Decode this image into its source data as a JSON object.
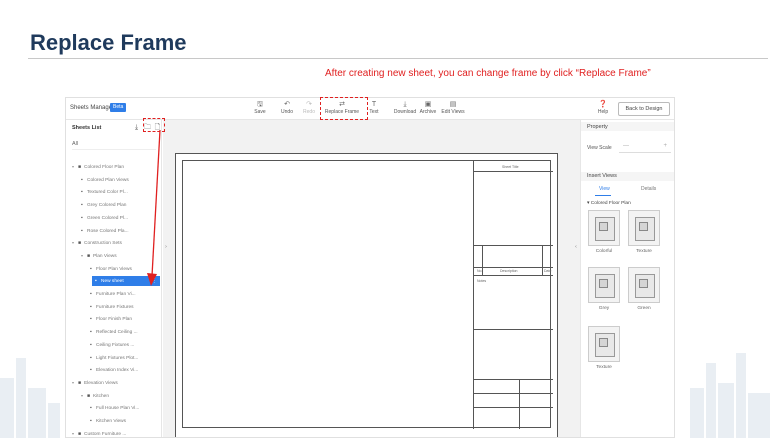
{
  "slide": {
    "title": "Replace Frame",
    "caption": "After creating new sheet, you can change frame by click “Replace Frame”"
  },
  "app": {
    "title": "Sheets Manager",
    "badge": "Beta",
    "toolbar": [
      {
        "label": "Save",
        "icon": "save-icon",
        "disabled": false
      },
      {
        "label": "Undo",
        "icon": "undo-icon",
        "disabled": false
      },
      {
        "label": "Redo",
        "icon": "redo-icon",
        "disabled": true
      },
      {
        "label": "Replace Frame",
        "icon": "replace-frame-icon",
        "disabled": false
      },
      {
        "label": "Text",
        "icon": "text-icon",
        "disabled": false
      },
      {
        "label": "Download",
        "icon": "download-icon",
        "disabled": false
      },
      {
        "label": "Archive",
        "icon": "archive-icon",
        "disabled": false
      },
      {
        "label": "Edit Views",
        "icon": "edit-views-icon",
        "disabled": false
      }
    ],
    "help_label": "Help",
    "back_button": "Back to Design"
  },
  "sidebar": {
    "title": "Sheets List",
    "search_value": "All",
    "tree": [
      {
        "label": "Colored Floor Plan",
        "level": 0,
        "type": "folder",
        "expanded": true
      },
      {
        "label": "Colored Plan Views",
        "level": 1,
        "type": "sheet"
      },
      {
        "label": "Textured Color Pl...",
        "level": 1,
        "type": "sheet"
      },
      {
        "label": "Grey Colored Plan",
        "level": 1,
        "type": "sheet"
      },
      {
        "label": "Green Colored Pl...",
        "level": 1,
        "type": "sheet"
      },
      {
        "label": "Rose Colored Pla...",
        "level": 1,
        "type": "sheet"
      },
      {
        "label": "Construction Sets",
        "level": 0,
        "type": "folder",
        "expanded": true
      },
      {
        "label": "Plan Views",
        "level": 1,
        "type": "folder",
        "expanded": true
      },
      {
        "label": "Floor Plan Views",
        "level": 2,
        "type": "sheet"
      },
      {
        "label": "New sheet",
        "level": 2,
        "type": "sheet",
        "selected": true
      },
      {
        "label": "Furniture Plan Vi...",
        "level": 2,
        "type": "sheet"
      },
      {
        "label": "Furniture Fixtures",
        "level": 2,
        "type": "sheet"
      },
      {
        "label": "Floor Finish Plan",
        "level": 2,
        "type": "sheet"
      },
      {
        "label": "Reflected Ceiling ...",
        "level": 2,
        "type": "sheet"
      },
      {
        "label": "Ceiling Fixtures ...",
        "level": 2,
        "type": "sheet"
      },
      {
        "label": "Light Fixtures Plot...",
        "level": 2,
        "type": "sheet"
      },
      {
        "label": "Elevation Index Vi...",
        "level": 2,
        "type": "sheet"
      },
      {
        "label": "Elevation Views",
        "level": 0,
        "type": "folder",
        "expanded": true
      },
      {
        "label": "Kitchen",
        "level": 1,
        "type": "folder",
        "expanded": true
      },
      {
        "label": "Full House Plan Vi...",
        "level": 2,
        "type": "sheet"
      },
      {
        "label": "Kitchen Views",
        "level": 2,
        "type": "sheet"
      },
      {
        "label": "Custom Furniture ...",
        "level": 0,
        "type": "folder",
        "expanded": true
      }
    ]
  },
  "titleblock": {
    "header": "Sheet Title",
    "row_no": "No.",
    "row_desc": "Description",
    "row_date": "Date",
    "notes_label": "Notes"
  },
  "right_panel": {
    "property_title": "Property",
    "view_scale_label": "View Scale",
    "view_scale_value": "—",
    "insert_title": "Insert Views",
    "tabs": [
      "View",
      "Details"
    ],
    "active_tab": 0,
    "group_label": "▾ Colored Floor Plan",
    "views": [
      {
        "label": "Colorful"
      },
      {
        "label": "Texture"
      },
      {
        "label": "Grey"
      },
      {
        "label": "Green"
      },
      {
        "label": "Texture"
      }
    ]
  },
  "colors": {
    "accent": "#2f7ee8",
    "annotation": "#e02020",
    "title": "#1f3a5c"
  }
}
